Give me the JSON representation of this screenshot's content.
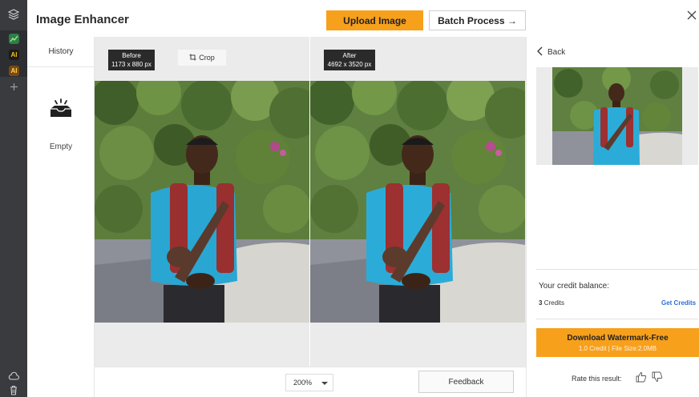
{
  "header": {
    "title": "Image Enhancer",
    "upload_label": "Upload Image",
    "batch_label": "Batch Process →"
  },
  "history": {
    "tab_label": "History",
    "empty_label": "Empty"
  },
  "compare": {
    "before_label": "Before",
    "before_size": "1173 x 880 px",
    "after_label": "After",
    "after_size": "4692 x 3520 px",
    "crop_label": "Crop"
  },
  "bottombar": {
    "zoom_value": "200%",
    "feedback_label": "Feedback"
  },
  "right_panel": {
    "back_label": "Back",
    "credit_title": "Your credit balance:",
    "credit_number": "3",
    "credit_unit": "Credits",
    "get_credits_label": "Get Credits",
    "download_title": "Download Watermark-Free",
    "download_sub": "1.0 Credit | File Size:2.0MB",
    "rate_label": "Rate this result:"
  },
  "icons": {
    "rail_top": "stack-layers-icon",
    "rail_bottom": [
      "cloud-icon",
      "trash-icon"
    ],
    "history_empty": "empty-tray-icon",
    "crop": "crop-icon",
    "back": "chevron-left-icon",
    "close": "close-icon",
    "zoom": "caret-down-icon",
    "rate": [
      "thumbs-up-icon",
      "thumbs-down-icon"
    ]
  },
  "colors": {
    "accent_orange": "#f7a01c",
    "link_blue": "#2c6fd6",
    "rail_dark": "#3a3b3f"
  }
}
